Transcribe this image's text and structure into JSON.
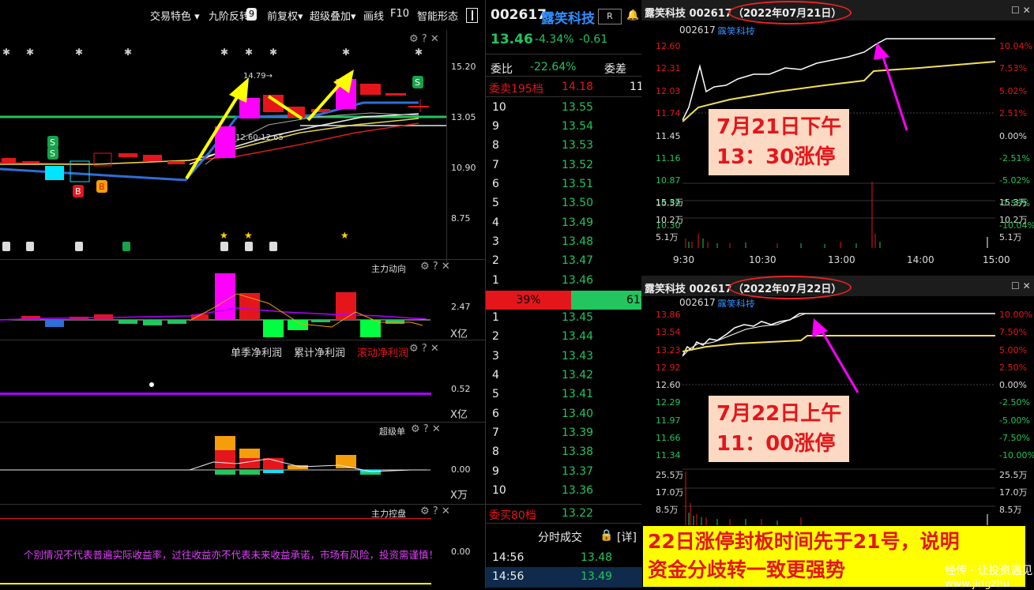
{
  "toolbar": {
    "items": [
      "交易特色 ▾",
      "九阶反转",
      "9",
      "前复权▾",
      "超级叠加▾",
      "画线",
      "F10",
      "智能形态"
    ]
  },
  "kline": {
    "y_labels": [
      "15.20",
      "13.05",
      "10.90",
      "8.75"
    ],
    "ann_high": "14.79→",
    "ann_range": "12.60-12.65",
    "markers": [
      "S",
      "S",
      "B",
      "B",
      "S"
    ]
  },
  "sub1": {
    "title": "主力动向",
    "value": "2.47",
    "unit": "X亿"
  },
  "sub2": {
    "title_a": "单季净利润",
    "title_b": "累计净利润",
    "title_c": "滚动净利润",
    "value": "0.52",
    "unit": "X亿"
  },
  "sub3": {
    "title": "超级单",
    "value": "0.00",
    "unit": "X万"
  },
  "sub4": {
    "title": "主力控盘",
    "disclaimer": "个别情况不代表普遍实际收益率，过往收益亦不代表未来收益承诺，市场有风险，投资需谨慎！",
    "value": "0.00"
  },
  "quote": {
    "code": "002617",
    "name": "露笑科技",
    "badge": "R",
    "price": "13.46",
    "pct": "-4.34%",
    "chg": "-0.61",
    "webi_label": "委比",
    "webi_value": "-22.64%",
    "wecha_label": "委差",
    "wecha_value": "11",
    "sell_label": "委卖195档",
    "sell_price": "14.18",
    "sell_qty": "11",
    "asks": [
      {
        "level": "10",
        "price": "13.55"
      },
      {
        "level": "9",
        "price": "13.54"
      },
      {
        "level": "8",
        "price": "13.53"
      },
      {
        "level": "7",
        "price": "13.52"
      },
      {
        "level": "6",
        "price": "13.51"
      },
      {
        "level": "5",
        "price": "13.50"
      },
      {
        "level": "4",
        "price": "13.49"
      },
      {
        "level": "3",
        "price": "13.48"
      },
      {
        "level": "2",
        "price": "13.47"
      },
      {
        "level": "1",
        "price": "13.46"
      }
    ],
    "ratio_sell": "39%",
    "ratio_buy": "61%",
    "bids": [
      {
        "level": "1",
        "price": "13.45"
      },
      {
        "level": "2",
        "price": "13.44"
      },
      {
        "level": "3",
        "price": "13.43"
      },
      {
        "level": "4",
        "price": "13.42"
      },
      {
        "level": "5",
        "price": "13.41"
      },
      {
        "level": "6",
        "price": "13.40"
      },
      {
        "level": "7",
        "price": "13.39"
      },
      {
        "level": "8",
        "price": "13.38"
      },
      {
        "level": "9",
        "price": "13.37"
      },
      {
        "level": "10",
        "price": "13.36"
      }
    ],
    "buy_label": "委买80档",
    "buy_price": "13.22",
    "ticks_title": "分时成交",
    "ticks_detail": "[详]",
    "ticks": [
      {
        "time": "14:56",
        "price": "13.48"
      },
      {
        "time": "14:56",
        "price": "13.49"
      }
    ]
  },
  "chart1": {
    "title": "露笑科技 002617",
    "date": "（2022年07月21日）",
    "sub": "002617",
    "sub_name": "露笑科技",
    "left_labels": [
      "12.60",
      "12.31",
      "12.03",
      "11.74",
      "11.45",
      "11.16",
      "10.87",
      "10.59",
      "10.30"
    ],
    "right_labels": [
      "10.04%",
      "7.53%",
      "5.02%",
      "2.51%",
      "0.00%",
      "-2.51%",
      "-5.02%",
      "-7.53%",
      "-10.04%"
    ],
    "vol_labels": [
      "15.3万",
      "10.2万",
      "5.1万"
    ],
    "x_labels": [
      "9:30",
      "10:30",
      "13:00",
      "14:00",
      "15:00"
    ],
    "note_line1": "7月21日下午",
    "note_line2": "13：30涨停"
  },
  "chart2": {
    "title": "露笑科技 002617",
    "date": "（2022年07月22日）",
    "sub": "002617",
    "sub_name": "露笑科技",
    "left_labels": [
      "13.86",
      "13.54",
      "13.23",
      "12.92",
      "12.60",
      "12.29",
      "11.97",
      "11.66",
      "11.34"
    ],
    "right_labels": [
      "10.00%",
      "7.50%",
      "5.00%",
      "2.50%",
      "0.00%",
      "-2.50%",
      "-5.00%",
      "-7.50%",
      "-10.00%"
    ],
    "vol_labels": [
      "25.5万",
      "17.0万",
      "8.5万"
    ],
    "note_line1": "7月22日上午",
    "note_line2": "11：00涨停"
  },
  "summary": {
    "line1": "22日涨停封板时间先于21号，说明",
    "line2": "资金分歧转一致更强势"
  },
  "watermark": {
    "text": "经传 · 让投资遇见",
    "url": "www.jingzhu"
  },
  "colors": {
    "up": "#e4161b",
    "down": "#22c55e",
    "accent": "#ffff00",
    "highlight": "#ff00ff"
  }
}
